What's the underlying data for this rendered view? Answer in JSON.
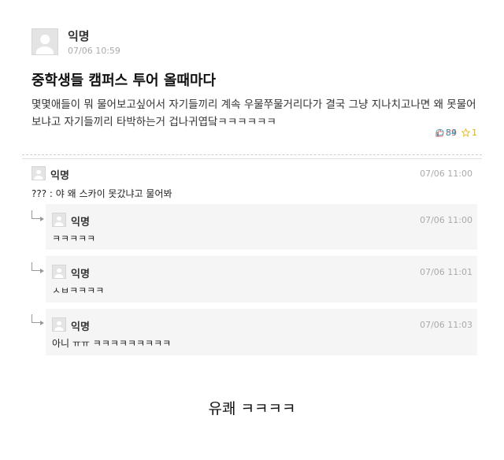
{
  "post": {
    "author": "익명",
    "time": "07/06 10:59",
    "title": "중학생들 캠퍼스 투어 올때마다",
    "body": "몇몇애들이 뭐 물어보고싶어서 자기들끼리 계속 우물쭈물거리다가 결국 그냥 지나치고나면 왜 못물어보냐고 자기들끼리 타박하는거 겁나귀엽닼ㅋㅋㅋㅋㅋㅋ",
    "likes": "89",
    "comments": "54",
    "scraps": "1"
  },
  "comments": [
    {
      "author": "익명",
      "time": "07/06 11:00",
      "text": "??? : 야 왜 스카이 못갔냐고 물어봐",
      "replies": [
        {
          "author": "익명",
          "time": "07/06 11:00",
          "text": "ㅋㅋㅋㅋㅋ"
        },
        {
          "author": "익명",
          "time": "07/06 11:01",
          "text": "ㅅㅂㅋㅋㅋㅋ"
        },
        {
          "author": "익명",
          "time": "07/06 11:03",
          "text": "아니 ㅠㅠ ㅋㅋㅋㅋㅋㅋㅋㅋㅋ"
        }
      ]
    }
  ],
  "caption": "유쾌 ㅋㅋㅋㅋ",
  "colors": {
    "like": "#d64b4b",
    "comment": "#2ba6c6",
    "scrap": "#e0b400",
    "reply_bg": "#f5f5f5"
  }
}
